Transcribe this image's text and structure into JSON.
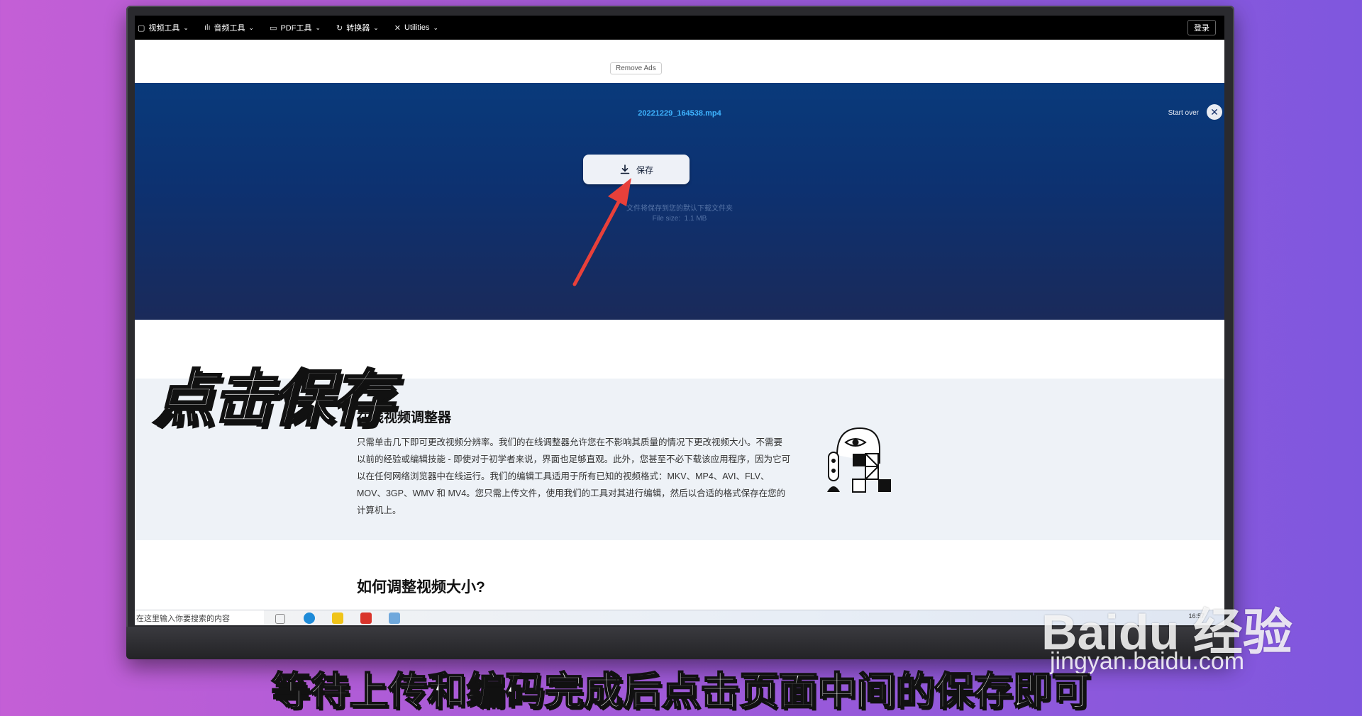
{
  "nav": {
    "items": [
      {
        "icon": "video-tools-icon",
        "label": "视频工具"
      },
      {
        "icon": "audio-tools-icon",
        "label": "音频工具"
      },
      {
        "icon": "pdf-tools-icon",
        "label": "PDF工具"
      },
      {
        "icon": "converter-icon",
        "label": "转换器"
      },
      {
        "icon": "utilities-icon",
        "label": "Utilities"
      }
    ],
    "login_label": "登录"
  },
  "ads": {
    "remove_label": "Remove Ads"
  },
  "hero": {
    "filename": "20221229_164538.mp4",
    "start_over_label": "Start over",
    "close_glyph": "✕",
    "save_label": "保存",
    "hint_text": "文件将保存到您的默认下载文件夹",
    "file_size_label": "File size:",
    "file_size_value": "1.1 MB"
  },
  "content": {
    "section1_title": "在线视频调整器",
    "section1_text": "只需单击几下即可更改视频分辨率。我们的在线调整器允许您在不影响其质量的情况下更改视频大小。不需要以前的经验或编辑技能 - 即使对于初学者来说，界面也足够直观。此外，您甚至不必下载该应用程序，因为它可以在任何网络浏览器中在线运行。我们的编辑工具适用于所有已知的视频格式：MKV、MP4、AVI、FLV、MOV、3GP、WMV 和 MV4。您只需上传文件，使用我们的工具对其进行编辑，然后以合适的格式保存在您的计算机上。",
    "section2_title": "如何调整视频大小?"
  },
  "taskbar": {
    "search_placeholder": "在这里输入你要搜索的内容",
    "clock": "16:57"
  },
  "overlay": {
    "title": "点击保存",
    "subtitle": "等待上传和编码完成后点击页面中间的保存即可",
    "watermark_logo": "Baidu 经验",
    "watermark_url": "jingyan.baidu.com"
  },
  "colors": {
    "nav_bg": "#000000",
    "hero_top": "#093a7b",
    "hero_bottom": "#1a2a5a",
    "filename": "#3fb4ff",
    "arrow": "#e8403a",
    "light_section": "#eef2f7"
  }
}
